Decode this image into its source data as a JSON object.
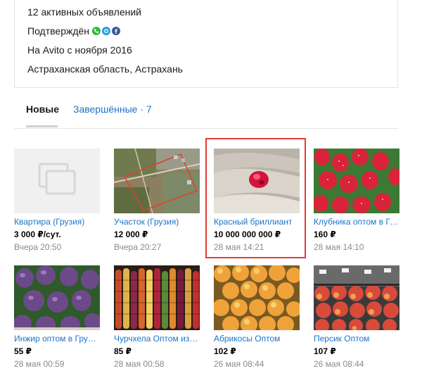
{
  "profile": {
    "active_listings": "12 активных объявлений",
    "verified_label": "Подтверждён",
    "verified_icons": [
      "phone-icon",
      "email-icon",
      "facebook-icon"
    ],
    "member_since": "На Avito с ноября 2016",
    "location": "Астраханская область, Астрахань"
  },
  "tabs": {
    "new_label": "Новые",
    "done_label": "Завершённые · 7"
  },
  "listings": [
    {
      "title": "Квартира (Грузия)",
      "price": "3 000 ₽/сут.",
      "date": "Вчера 20:50"
    },
    {
      "title": "Участок (Грузия)",
      "price": "12 000 ₽",
      "date": "Вчера 20:27"
    },
    {
      "title": "Красный бриллиант",
      "price": "10 000 000 000 ₽",
      "date": "28 мая 14:21"
    },
    {
      "title": "Клубника оптом в Грузии",
      "price": "160 ₽",
      "date": "28 мая 14:10"
    },
    {
      "title": "Инжир оптом в Грузии",
      "price": "55 ₽",
      "date": "28 мая 00:59"
    },
    {
      "title": "Чурчхела Оптом из Грузии",
      "price": "85 ₽",
      "date": "28 мая 00:58"
    },
    {
      "title": "Абрикосы Оптом",
      "price": "102 ₽",
      "date": "26 мая 08:44"
    },
    {
      "title": "Персик Оптом",
      "price": "107 ₽",
      "date": "26 мая 08:44"
    }
  ],
  "colors": {
    "link": "#1a73c9",
    "highlight": "#e53935",
    "phone_icon": "#38b54a",
    "email_icon": "#1e9be8",
    "facebook_icon": "#3b5998"
  }
}
